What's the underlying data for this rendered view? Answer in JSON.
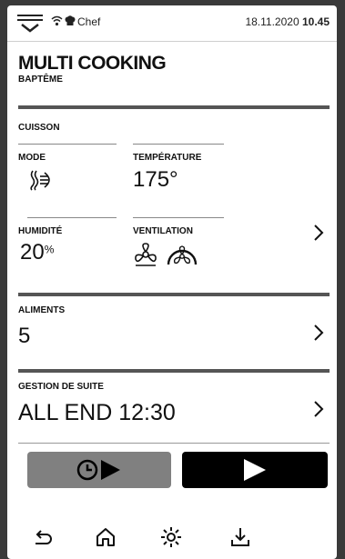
{
  "statusbar": {
    "user": "Chef",
    "date": "18.11.2020",
    "time": "10.45",
    "icons": [
      "menu-icon",
      "wifi-icon",
      "chef-hat-icon"
    ]
  },
  "header": {
    "title": "MULTI COOKING",
    "subtitle": "BAPTÊME"
  },
  "cuisson": {
    "section_label": "CUISSON",
    "mode_label": "MODE",
    "mode_icon": "steam-mode-icon",
    "temperature_label": "TEMPÉRATURE",
    "temperature_value": "175°",
    "humidity_label": "HUMIDITÉ",
    "humidity_value": "20",
    "humidity_unit": "%",
    "ventilation_label": "VENTILATION",
    "ventilation_icons": [
      "fan-icon",
      "fan-speed-gauge-icon"
    ]
  },
  "aliments": {
    "section_label": "ALIMENTS",
    "value": "5"
  },
  "gestion": {
    "section_label": "GESTION DE SUITE",
    "value": "ALL END 12:30"
  },
  "actions": {
    "timer_start_icon": "clock-play-icon",
    "start_icon": "play-icon"
  },
  "nav": {
    "icons": [
      "back-icon",
      "home-icon",
      "light-icon",
      "download-icon"
    ]
  },
  "colors": {
    "bar": "#555555",
    "timer_button": "#808080",
    "start_button": "#000000",
    "background": "#ffffff"
  }
}
